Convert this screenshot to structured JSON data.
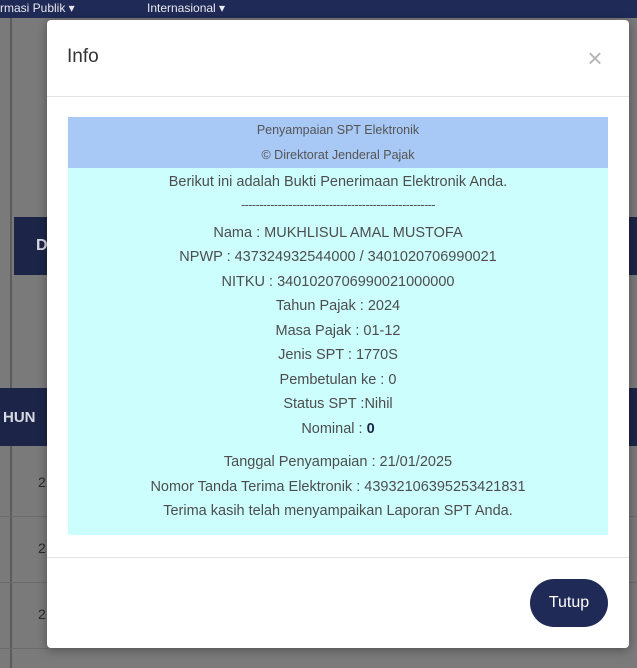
{
  "background": {
    "nav_items": [
      "rmasi Publik ▾",
      "Internasional ▾"
    ],
    "tab_letter": "D",
    "col_header": "HUN",
    "row_numbers": [
      "2",
      "2",
      "2"
    ]
  },
  "modal": {
    "title": "Info",
    "close_symbol": "×",
    "receipt": {
      "header_line1": "Penyampaian SPT Elektronik",
      "header_line2": "© Direktorat Jenderal Pajak",
      "intro": "Berikut ini adalah Bukti Penerimaan Elektronik Anda.",
      "separator": "-----------------------------------------------------",
      "nama": "Nama : MUKHLISUL AMAL MUSTOFA",
      "npwp": "NPWP : 437324932544000 / 3401020706990021",
      "nitku": "NITKU : 3401020706990021000000",
      "tahun_pajak": "Tahun Pajak : 2024",
      "masa_pajak": "Masa Pajak : 01-12",
      "jenis_spt": "Jenis SPT : 1770S",
      "pembetulan": "Pembetulan ke : 0",
      "status_spt": "Status SPT :Nihil",
      "nominal_label": "Nominal : ",
      "nominal_value": "0",
      "tanggal": "Tanggal Penyampaian : 21/01/2025",
      "nomor": "Nomor Tanda Terima Elektronik : 439321063952534218​31",
      "thanks": "Terima kasih telah menyampaikan Laporan SPT Anda."
    },
    "close_button_label": "Tutup"
  },
  "colors": {
    "navy": "#1f2a56",
    "receipt_bg": "#ccfefe",
    "receipt_header_bg": "#a8c8f5"
  }
}
